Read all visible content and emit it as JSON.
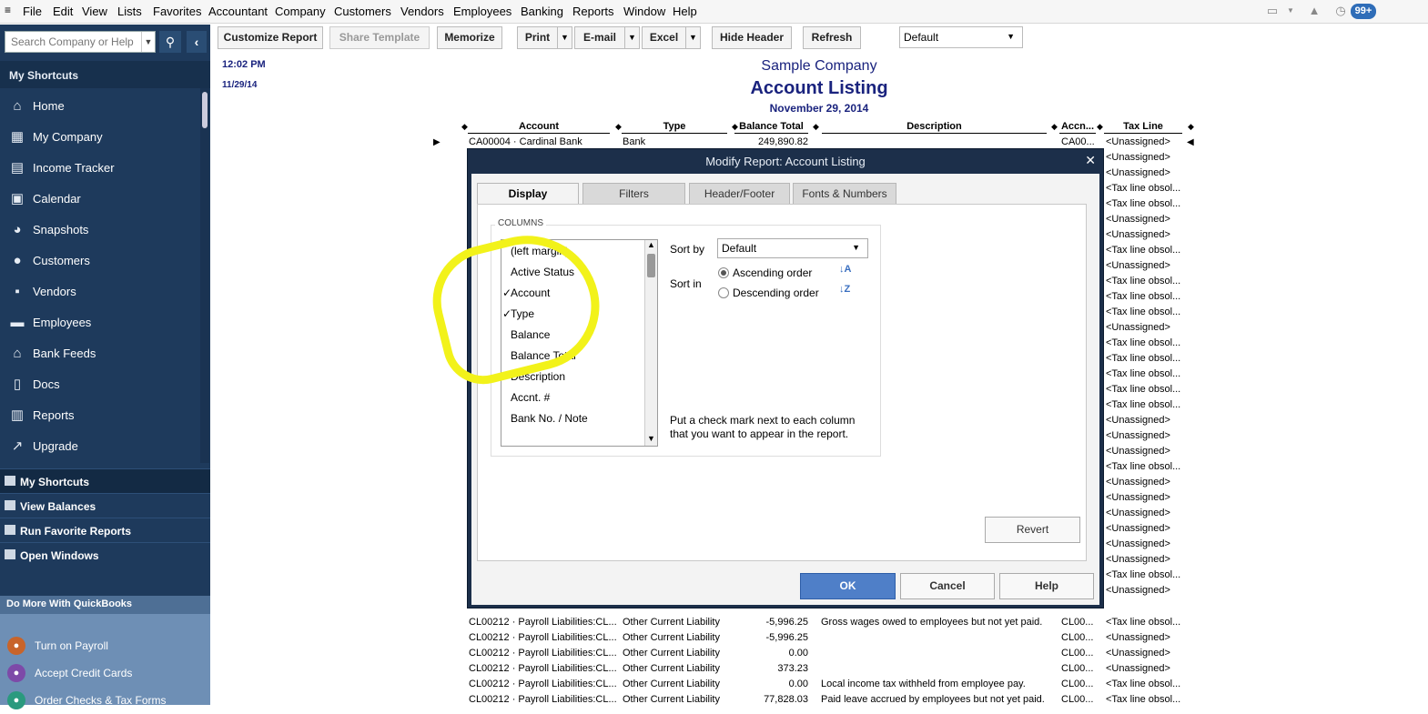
{
  "menubar": {
    "items": [
      "File",
      "Edit",
      "View",
      "Lists",
      "Favorites",
      "Accountant",
      "Company",
      "Customers",
      "Vendors",
      "Employees",
      "Banking",
      "Reports",
      "Window",
      "Help"
    ],
    "badge": "99+"
  },
  "sidebar": {
    "search_placeholder": "Search Company or Help",
    "title": "My Shortcuts",
    "items": [
      {
        "label": "Home",
        "icon": "home-icon",
        "glyph": "⌂"
      },
      {
        "label": "My Company",
        "icon": "company-icon",
        "glyph": "▦"
      },
      {
        "label": "Income Tracker",
        "icon": "income-tracker-icon",
        "glyph": "▤"
      },
      {
        "label": "Calendar",
        "icon": "calendar-icon",
        "glyph": "▣"
      },
      {
        "label": "Snapshots",
        "icon": "pie-chart-icon",
        "glyph": "◕"
      },
      {
        "label": "Customers",
        "icon": "customer-icon",
        "glyph": "●"
      },
      {
        "label": "Vendors",
        "icon": "vendor-icon",
        "glyph": "▪"
      },
      {
        "label": "Employees",
        "icon": "employees-icon",
        "glyph": "▬"
      },
      {
        "label": "Bank Feeds",
        "icon": "bank-icon",
        "glyph": "⌂"
      },
      {
        "label": "Docs",
        "icon": "document-icon",
        "glyph": "▯"
      },
      {
        "label": "Reports",
        "icon": "reports-icon",
        "glyph": "▥"
      },
      {
        "label": "Upgrade",
        "icon": "upgrade-icon",
        "glyph": "↗"
      }
    ],
    "bottom_tabs": [
      "My Shortcuts",
      "View Balances",
      "Run Favorite Reports",
      "Open Windows"
    ],
    "do_more": {
      "title": "Do More With QuickBooks",
      "items": [
        {
          "label": "Turn on Payroll",
          "icon": "payroll-icon",
          "color": "#c8642a"
        },
        {
          "label": "Accept Credit Cards",
          "icon": "credit-card-icon",
          "color": "#7d4aa8"
        },
        {
          "label": "Order Checks & Tax Forms",
          "icon": "checks-icon",
          "color": "#2a9a7e"
        }
      ]
    }
  },
  "toolbar": {
    "customize": "Customize Report",
    "share": "Share Template",
    "memorize": "Memorize",
    "print": "Print",
    "email": "E-mail",
    "excel": "Excel",
    "hide_header": "Hide Header",
    "refresh": "Refresh",
    "default_select": "Default"
  },
  "report": {
    "time": "12:02 PM",
    "date_short": "11/29/14",
    "company": "Sample Company",
    "title": "Account Listing",
    "date": "November 29, 2014",
    "columns": [
      "Account",
      "Type",
      "Balance Total",
      "Description",
      "Accn...",
      "Tax Line"
    ],
    "first_row": [
      "CA00004 · Cardinal Bank",
      "Bank",
      "249,890.82",
      "",
      "CA00...",
      "<Unassigned>"
    ],
    "tax_lines": [
      "<Unassigned>",
      "<Unassigned>",
      "<Tax line obsol...",
      "<Tax line obsol...",
      "<Unassigned>",
      "<Unassigned>",
      "<Tax line obsol...",
      "<Unassigned>",
      "<Tax line obsol...",
      "<Tax line obsol...",
      "<Tax line obsol...",
      "<Unassigned>",
      "<Tax line obsol...",
      "<Tax line obsol...",
      "<Tax line obsol...",
      "<Tax line obsol...",
      "<Tax line obsol...",
      "<Unassigned>",
      "<Unassigned>",
      "<Unassigned>",
      "<Tax line obsol...",
      "<Unassigned>",
      "<Unassigned>",
      "<Unassigned>",
      "<Unassigned>",
      "<Unassigned>",
      "<Unassigned>",
      "<Tax line obsol...",
      "<Unassigned>"
    ],
    "bottom_rows": [
      [
        "CL00212 · Payroll Liabilities:CL...",
        "Other Current Liability",
        "-5,996.25",
        "Gross wages owed to employees but not yet paid.",
        "CL00...",
        "<Tax line obsol..."
      ],
      [
        "CL00212 · Payroll Liabilities:CL...",
        "Other Current Liability",
        "-5,996.25",
        "",
        "CL00...",
        "<Unassigned>"
      ],
      [
        "CL00212 · Payroll Liabilities:CL...",
        "Other Current Liability",
        "0.00",
        "",
        "CL00...",
        "<Unassigned>"
      ],
      [
        "CL00212 · Payroll Liabilities:CL...",
        "Other Current Liability",
        "373.23",
        "",
        "CL00...",
        "<Unassigned>"
      ],
      [
        "CL00212 · Payroll Liabilities:CL...",
        "Other Current Liability",
        "0.00",
        "Local income tax withheld from employee pay.",
        "CL00...",
        "<Tax line obsol..."
      ],
      [
        "CL00212 · Payroll Liabilities:CL...",
        "Other Current Liability",
        "77,828.03",
        "Paid leave accrued by employees but not yet paid.",
        "CL00...",
        "<Tax line obsol..."
      ]
    ]
  },
  "dialog": {
    "title": "Modify Report: Account Listing",
    "tabs": [
      "Display",
      "Filters",
      "Header/Footer",
      "Fonts & Numbers"
    ],
    "columns_label": "COLUMNS",
    "column_items": [
      {
        "label": "(left margin)",
        "check": ""
      },
      {
        "label": "Active Status",
        "check": ""
      },
      {
        "label": "Account",
        "check": "✓"
      },
      {
        "label": "Type",
        "check": "✓"
      },
      {
        "label": "Balance",
        "check": ""
      },
      {
        "label": "Balance Total",
        "check": ""
      },
      {
        "label": "Description",
        "check": ""
      },
      {
        "label": "Accnt. #",
        "check": ""
      },
      {
        "label": "Bank No. / Note",
        "check": ""
      }
    ],
    "sort_by_label": "Sort by",
    "sort_by_value": "Default",
    "sort_in_label": "Sort in",
    "ascending": "Ascending order",
    "descending": "Descending order",
    "hint_line1": "Put a check mark next to each column",
    "hint_line2": "that you want to appear in the report.",
    "revert": "Revert",
    "ok": "OK",
    "cancel": "Cancel",
    "help": "Help"
  }
}
